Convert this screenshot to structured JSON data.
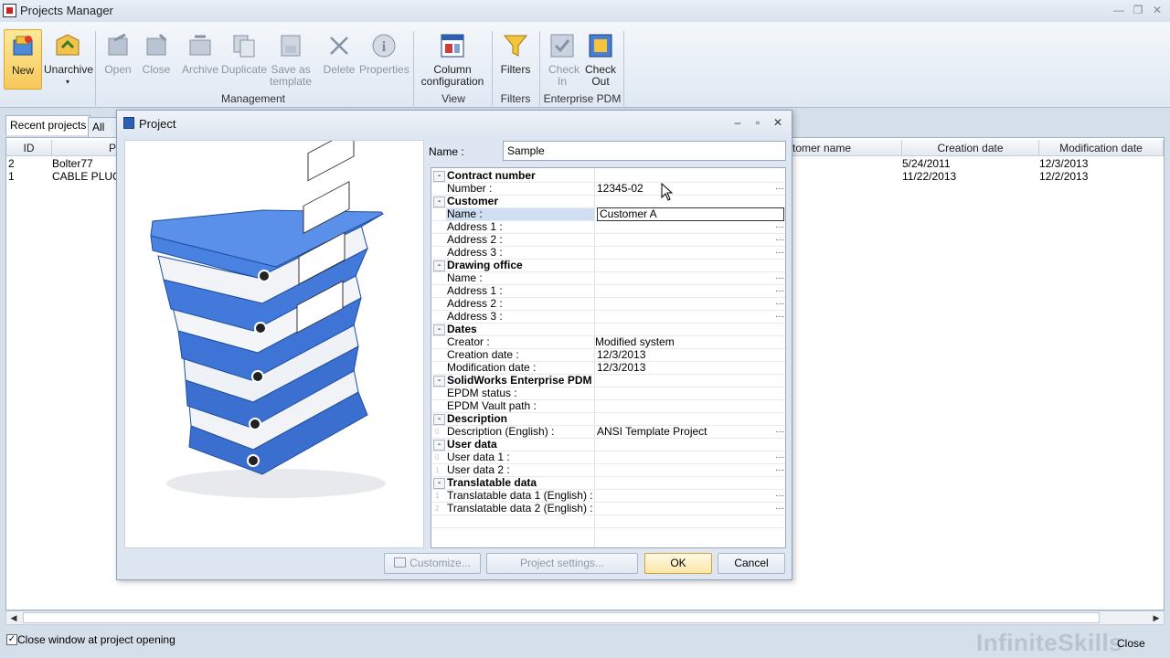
{
  "window": {
    "title": "Projects Manager"
  },
  "ribbon": {
    "buttons": [
      {
        "label": "New",
        "icon": "new-project-icon"
      },
      {
        "label": "Unarchive",
        "icon": "unarchive-icon"
      },
      {
        "label": "Open",
        "icon": "open-icon"
      },
      {
        "label": "Close",
        "icon": "close-project-icon"
      },
      {
        "label": "Archive",
        "icon": "archive-icon"
      },
      {
        "label": "Duplicate",
        "icon": "duplicate-icon"
      },
      {
        "label": "Save as template",
        "icon": "save-template-icon"
      },
      {
        "label": "Delete",
        "icon": "delete-icon"
      },
      {
        "label": "Properties",
        "icon": "info-icon"
      },
      {
        "label": "Column configuration",
        "icon": "column-config-icon"
      },
      {
        "label": "Filters",
        "icon": "funnel-icon"
      },
      {
        "label": "Check In",
        "icon": "check-in-icon"
      },
      {
        "label": "Check Out",
        "icon": "check-out-icon"
      }
    ],
    "groups": {
      "management": "Management",
      "view": "View",
      "filters": "Filters",
      "epdm": "Enterprise PDM"
    }
  },
  "tabs": {
    "recent": "Recent projects",
    "all": "All pro"
  },
  "grid": {
    "headers": {
      "id": "ID",
      "p": "P",
      "customer": "tomer name",
      "creation": "Creation date",
      "modification": "Modification date"
    },
    "rows": [
      {
        "id": "2",
        "name": "Bolter77",
        "creation": "5/24/2011",
        "modification": "12/3/2013"
      },
      {
        "id": "1",
        "name": "CABLE PLUG D",
        "creation": "11/22/2013",
        "modification": "12/2/2013"
      }
    ]
  },
  "footer": {
    "checkbox_label": "Close window at project opening",
    "checked": true,
    "close_label": "Close",
    "watermark": "InfiniteSkills"
  },
  "dialog": {
    "title": "Project",
    "name_label": "Name :",
    "name_value": "Sample",
    "properties": {
      "contract": {
        "title": "Contract number",
        "number_label": "Number :",
        "number_value": "12345-02"
      },
      "customer": {
        "title": "Customer",
        "name_label": "Name :",
        "name_value": "Customer A",
        "addr1": "Address 1 :",
        "addr2": "Address 2 :",
        "addr3": "Address 3 :"
      },
      "office": {
        "title": "Drawing office",
        "name_label": "Name :",
        "addr1": "Address 1 :",
        "addr2": "Address 2 :",
        "addr3": "Address 3 :"
      },
      "dates": {
        "title": "Dates",
        "creator_label": "Creator :",
        "creator_value": "Modified system",
        "creation_label": "Creation date :",
        "creation_value": "12/3/2013",
        "mod_label": "Modification date :",
        "mod_value": "12/3/2013"
      },
      "epdm": {
        "title": "SolidWorks Enterprise PDM",
        "status_label": "EPDM status :",
        "vault_label": "EPDM Vault path :"
      },
      "description": {
        "title": "Description",
        "desc_label": "Description (English) :",
        "desc_value": "ANSI Template Project"
      },
      "userdata": {
        "title": "User data",
        "u1": "User data 1 :",
        "u2": "User data 2 :"
      },
      "translatable": {
        "title": "Translatable data",
        "t1": "Translatable data 1 (English) :",
        "t2": "Translatable data 2 (English) :"
      }
    },
    "buttons": {
      "customize": "Customize...",
      "settings": "Project settings...",
      "ok": "OK",
      "cancel": "Cancel"
    }
  }
}
